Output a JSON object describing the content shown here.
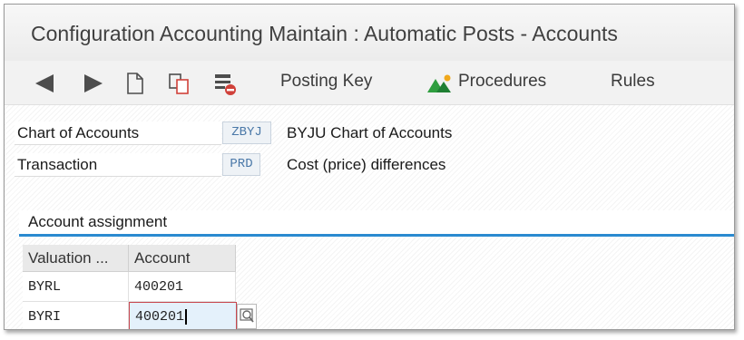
{
  "window": {
    "title": "Configuration Accounting Maintain : Automatic Posts - Accounts"
  },
  "toolbar": {
    "back_icon": "back-arrow-icon",
    "forward_icon": "forward-arrow-icon",
    "new_icon": "new-document-icon",
    "copy_icon": "copy-document-icon",
    "delete_icon": "delete-row-icon",
    "posting_key_label": "Posting Key",
    "procedures_label": "Procedures",
    "rules_label": "Rules"
  },
  "header_fields": [
    {
      "label": "Chart of Accounts",
      "code": "ZBYJ",
      "description": "BYJU Chart of Accounts"
    },
    {
      "label": "Transaction",
      "code": "PRD",
      "description": "Cost (price) differences"
    }
  ],
  "panel": {
    "title": "Account assignment"
  },
  "table": {
    "columns": [
      "Valuation ...",
      "Account"
    ],
    "rows": [
      [
        "BYRL",
        "400201"
      ],
      [
        "BYRI",
        "400201"
      ]
    ],
    "active_cell": "row-2-account"
  },
  "colors": {
    "accent": "#2a8ad0",
    "focus_border": "#c9474f",
    "code_text": "#4a78a8"
  }
}
